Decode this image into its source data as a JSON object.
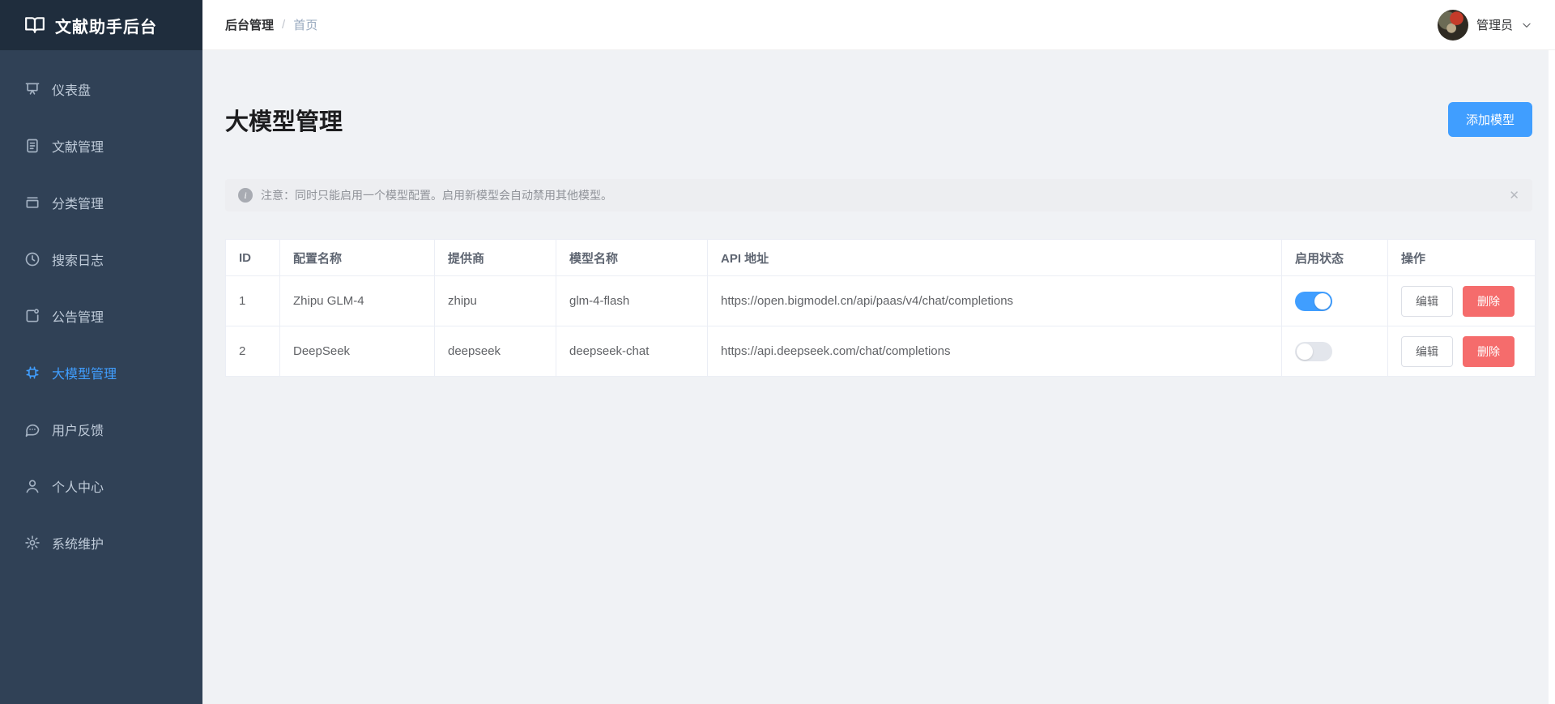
{
  "app": {
    "logo_title": "文献助手后台"
  },
  "sidebar": {
    "items": [
      {
        "label": "仪表盘",
        "icon": "dashboard-icon"
      },
      {
        "label": "文献管理",
        "icon": "document-icon"
      },
      {
        "label": "分类管理",
        "icon": "category-icon"
      },
      {
        "label": "搜索日志",
        "icon": "clock-icon"
      },
      {
        "label": "公告管理",
        "icon": "announcement-icon"
      },
      {
        "label": "大模型管理",
        "icon": "chip-icon",
        "active": true
      },
      {
        "label": "用户反馈",
        "icon": "feedback-icon"
      },
      {
        "label": "个人中心",
        "icon": "user-icon"
      },
      {
        "label": "系统维护",
        "icon": "gear-icon"
      }
    ]
  },
  "header": {
    "breadcrumb_root": "后台管理",
    "breadcrumb_separator": "/",
    "breadcrumb_current": "首页",
    "user_name": "管理员"
  },
  "page": {
    "title": "大模型管理",
    "add_button_label": "添加模型"
  },
  "notice": {
    "text": "注意：同时只能启用一个模型配置。启用新模型会自动禁用其他模型。",
    "close_glyph": "✕"
  },
  "table": {
    "columns": {
      "id": "ID",
      "name": "配置名称",
      "provider": "提供商",
      "model": "模型名称",
      "api": "API 地址",
      "status": "启用状态",
      "actions": "操作"
    },
    "rows": [
      {
        "id": "1",
        "name": "Zhipu GLM-4",
        "provider": "zhipu",
        "model": "glm-4-flash",
        "api": "https://open.bigmodel.cn/api/paas/v4/chat/completions",
        "enabled": "on",
        "edit_label": "编辑",
        "delete_label": "删除"
      },
      {
        "id": "2",
        "name": "DeepSeek",
        "provider": "deepseek",
        "model": "deepseek-chat",
        "api": "https://api.deepseek.com/chat/completions",
        "enabled": "off",
        "edit_label": "编辑",
        "delete_label": "删除"
      }
    ]
  },
  "colors": {
    "accent": "#409eff",
    "danger": "#f56c6c",
    "sidebar_bg": "#304156",
    "sidebar_logo_bg": "#1f2d3d",
    "sidebar_text": "#bfcbd9",
    "content_bg": "#f0f2f5",
    "alert_bg": "#edeef1",
    "alert_text": "#909399",
    "table_border": "#ebeef5",
    "toggle_off": "#e3e6ec"
  }
}
